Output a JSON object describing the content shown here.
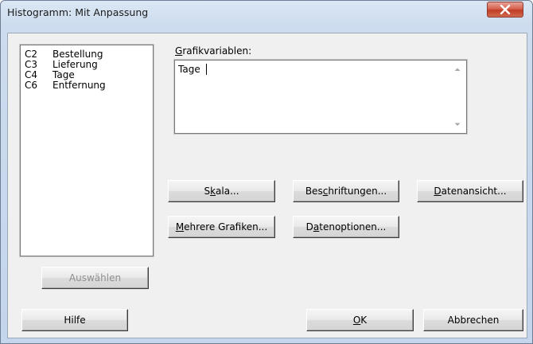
{
  "window": {
    "title": "Histogramm: Mit Anpassung",
    "close_icon": "close-icon"
  },
  "variables": [
    {
      "column": "C2",
      "name": "Bestellung"
    },
    {
      "column": "C3",
      "name": "Lieferung"
    },
    {
      "column": "C4",
      "name": "Tage"
    },
    {
      "column": "C6",
      "name": "Entfernung"
    }
  ],
  "graph_variables": {
    "label_accel": "G",
    "label_rest": "rafikvariablen:",
    "value": "Tage"
  },
  "buttons": {
    "scale": {
      "pre": "S",
      "accel": "k",
      "post": "ala..."
    },
    "labels": {
      "pre": "Bes",
      "accel": "c",
      "post": "hriftungen..."
    },
    "data_view": {
      "pre": "",
      "accel": "D",
      "post": "atenansicht..."
    },
    "multiple_graphs": {
      "pre": "",
      "accel": "M",
      "post": "ehrere Grafiken..."
    },
    "data_options": {
      "pre": "D",
      "accel": "a",
      "post": "tenoptionen..."
    },
    "select": "Auswählen",
    "help": "Hilfe",
    "ok": {
      "pre": "",
      "accel": "O",
      "post": "K"
    },
    "cancel": "Abbrechen"
  }
}
